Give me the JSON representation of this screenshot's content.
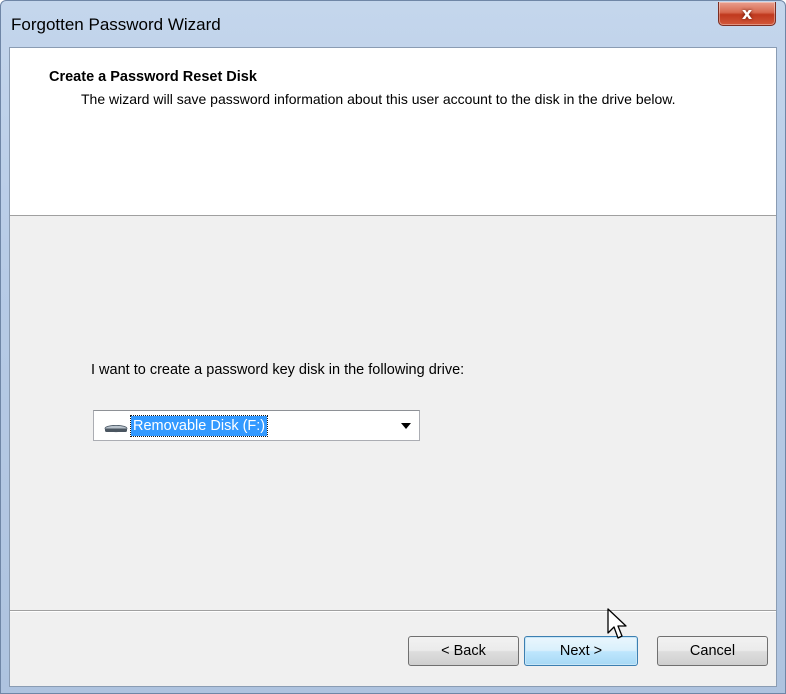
{
  "window": {
    "title": "Forgotten Password Wizard",
    "close_label": "x"
  },
  "header": {
    "title": "Create a Password Reset Disk",
    "description": "The wizard will save password information about this user account to the disk in the drive below."
  },
  "main": {
    "prompt": "I want to create a password key disk in the following drive:",
    "drive_select": {
      "selected": "Removable Disk (F:)",
      "icon": "removable-drive-icon"
    }
  },
  "buttons": {
    "back": "< Back",
    "next": "Next >",
    "cancel": "Cancel"
  },
  "colors": {
    "selection": "#3399ff",
    "frame": "#b7cbe6",
    "close": "#c7432a"
  }
}
